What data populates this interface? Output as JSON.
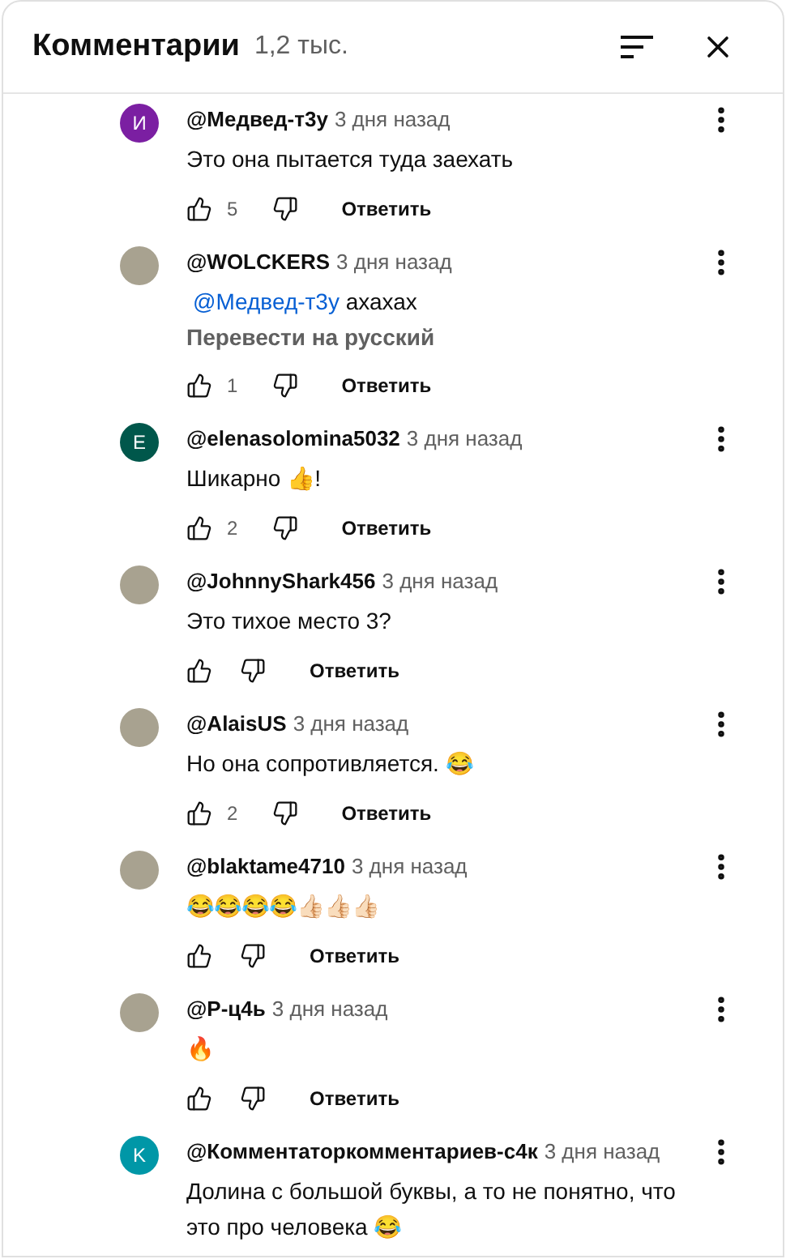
{
  "header": {
    "title": "Комментарии",
    "count": "1,2 тыс."
  },
  "comments": [
    {
      "avatar": {
        "kind": "letter",
        "letter": "И",
        "color": "#7b1fa2"
      },
      "author": "@Медвед-т3у",
      "time": "3 дня назад",
      "text": "Это она пытается туда заехать",
      "likes": "5",
      "reply": "Ответить"
    },
    {
      "avatar": {
        "kind": "image"
      },
      "author": "@WOLCKERS",
      "time": "3 дня назад",
      "mention": "@Медвед-т3у",
      "text": "ахахах",
      "translate": "Перевести на русский",
      "likes": "1",
      "reply": "Ответить"
    },
    {
      "avatar": {
        "kind": "letter",
        "letter": "E",
        "color": "#00574b"
      },
      "author": "@elenasolomina5032",
      "time": "3 дня назад",
      "text": "Шикарно 👍!",
      "likes": "2",
      "reply": "Ответить"
    },
    {
      "avatar": {
        "kind": "image"
      },
      "author": "@JohnnyShark456",
      "time": "3 дня назад",
      "text": "Это тихое место 3?",
      "reply": "Ответить"
    },
    {
      "avatar": {
        "kind": "image"
      },
      "author": "@AlaisUS",
      "time": "3 дня назад",
      "text": "Но она сопротивляется. 😂",
      "likes": "2",
      "reply": "Ответить"
    },
    {
      "avatar": {
        "kind": "image"
      },
      "author": "@blaktame4710",
      "time": "3 дня назад",
      "text": "😂😂😂😂👍🏻👍🏻👍🏻",
      "reply": "Ответить"
    },
    {
      "avatar": {
        "kind": "image"
      },
      "author": "@P-ц4ь",
      "time": "3 дня назад",
      "text": "🔥",
      "reply": "Ответить"
    },
    {
      "avatar": {
        "kind": "letter",
        "letter": "K",
        "color": "#0097a7"
      },
      "author": "@Комментаторкомментариев-с4к",
      "time": "3 дня назад",
      "text": "Долина с большой буквы, а то не понятно, что это про человека 😂"
    }
  ]
}
